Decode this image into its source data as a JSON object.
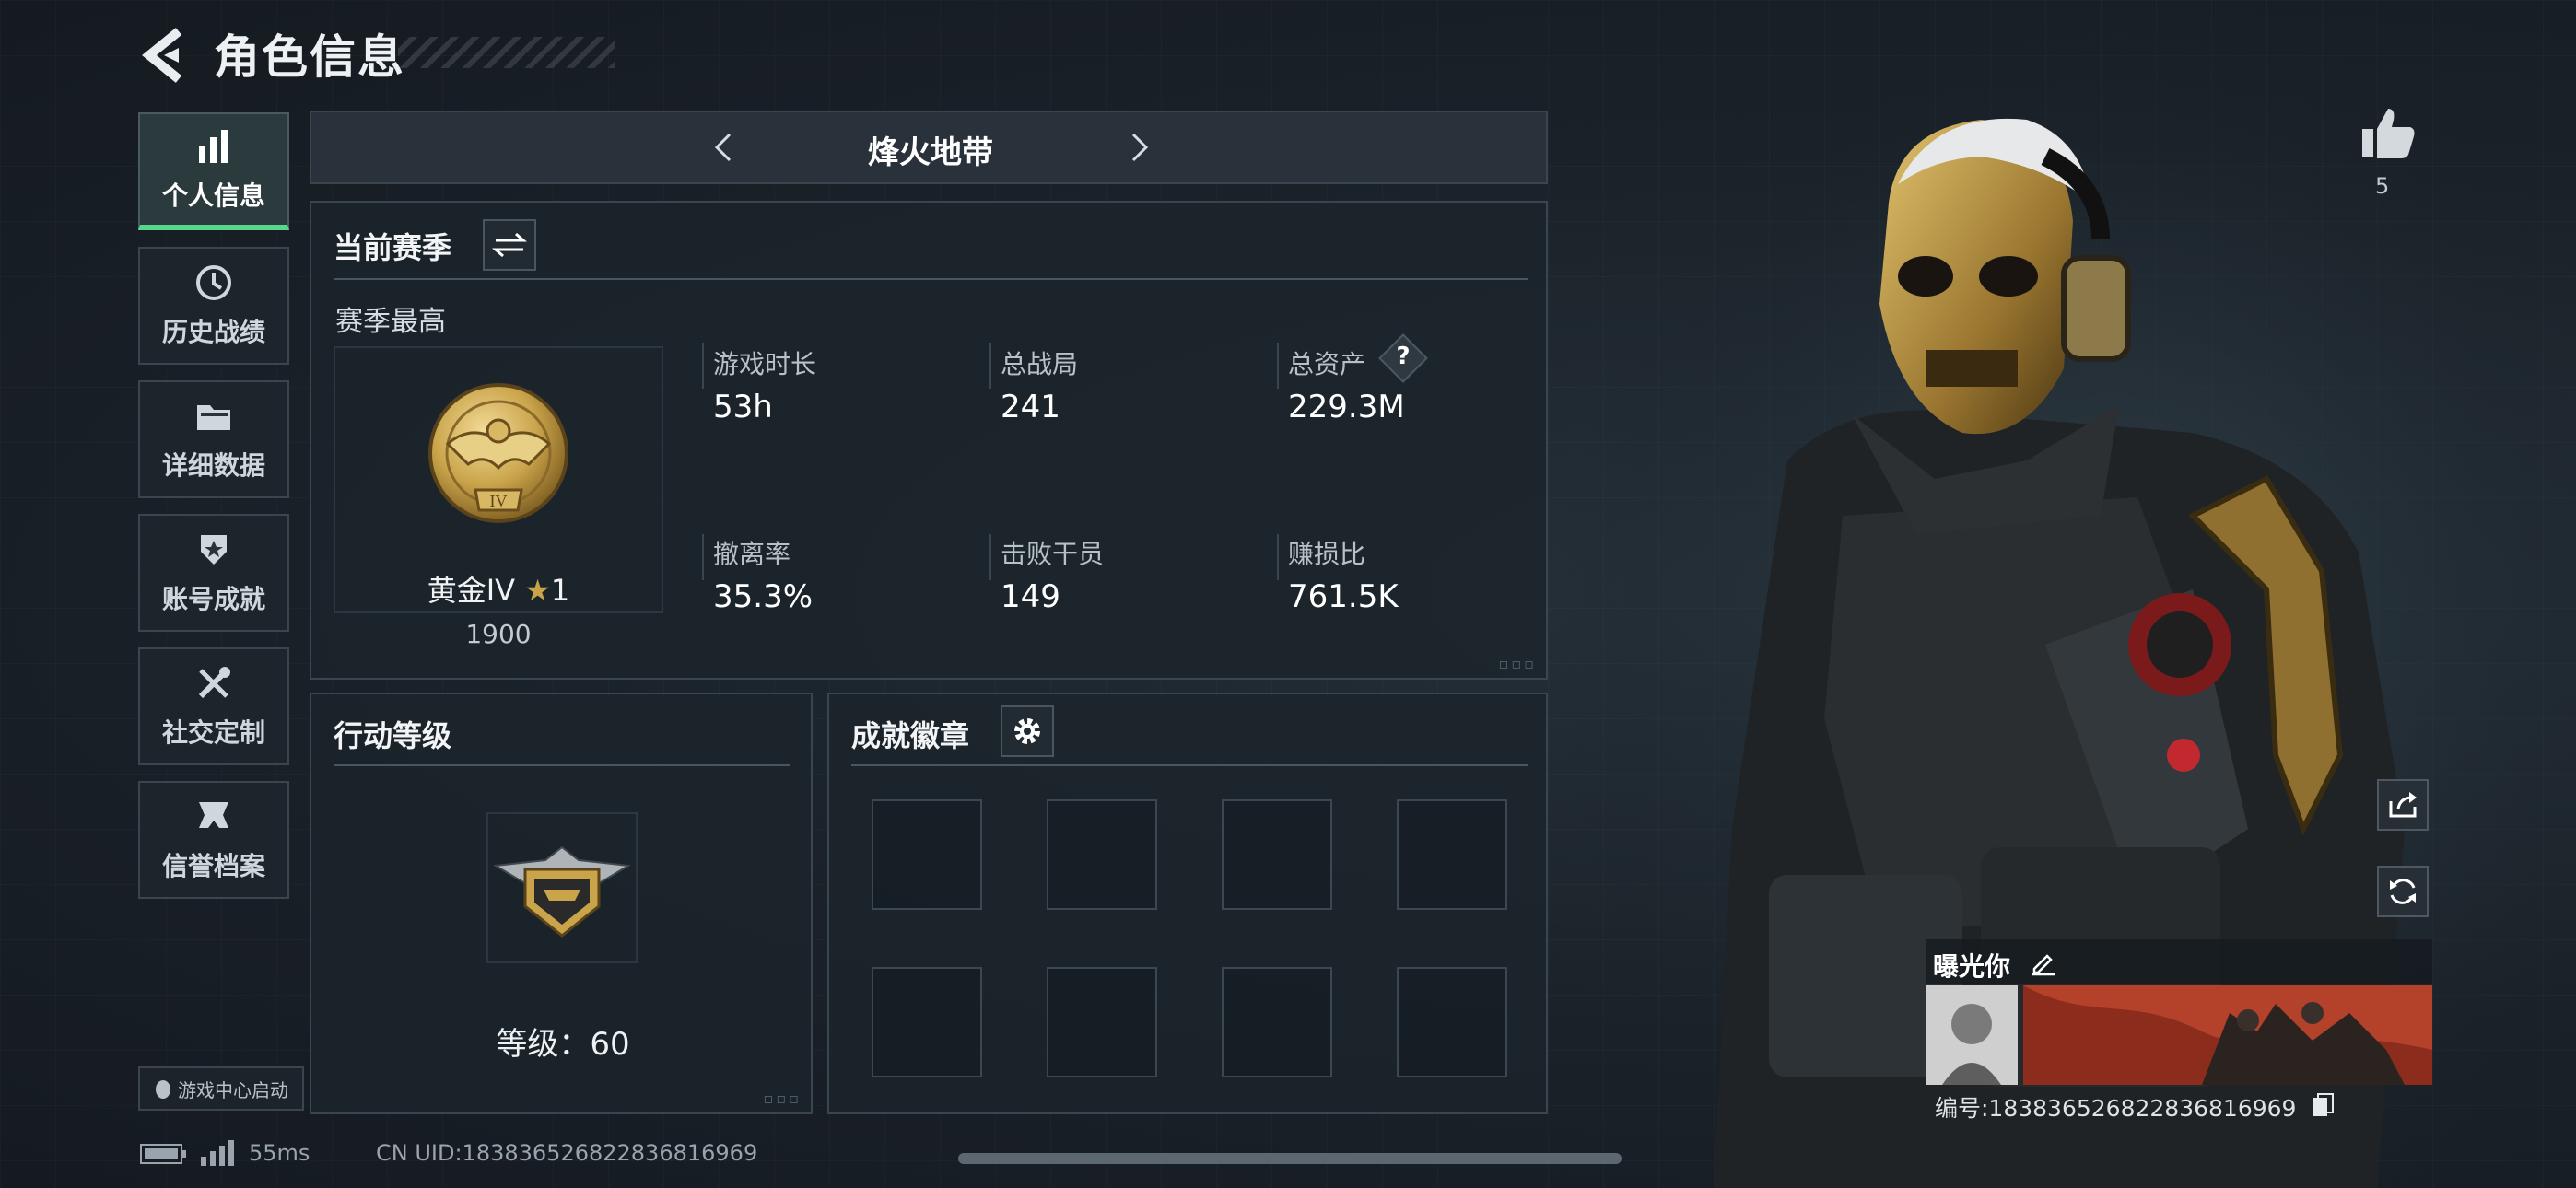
{
  "header": {
    "title": "角色信息"
  },
  "sidebar": {
    "items": [
      {
        "label": "个人信息",
        "icon": "bar-chart-icon",
        "active": true
      },
      {
        "label": "历史战绩",
        "icon": "history-icon",
        "active": false
      },
      {
        "label": "详细数据",
        "icon": "folder-icon",
        "active": false
      },
      {
        "label": "账号成就",
        "icon": "achievement-icon",
        "active": false
      },
      {
        "label": "社交定制",
        "icon": "tools-icon",
        "active": false
      },
      {
        "label": "信誉档案",
        "icon": "credit-icon",
        "active": false
      }
    ],
    "launch_label": "游戏中心启动"
  },
  "mode_selector": {
    "title": "烽火地带"
  },
  "season_panel": {
    "title": "当前赛季",
    "subtitle": "赛季最高",
    "rank_name": "黄金IV",
    "rank_stars": "1",
    "rank_points": "1900",
    "stats": [
      {
        "label": "游戏时长",
        "value": "53h"
      },
      {
        "label": "总战局",
        "value": "241"
      },
      {
        "label": "总资产",
        "value": "229.3M",
        "help": "?"
      },
      {
        "label": "撤离率",
        "value": "35.3%"
      },
      {
        "label": "击败干员",
        "value": "149"
      },
      {
        "label": "赚损比",
        "value": "761.5K"
      }
    ]
  },
  "action_panel": {
    "title": "行动等级",
    "level_label": "等级：",
    "level_value": "60"
  },
  "badge_panel": {
    "title": "成就徽章",
    "slots": 8
  },
  "status_bar": {
    "ping": "55ms",
    "uid": "CN UID:18383652682283681696​9"
  },
  "profile": {
    "likes": "5",
    "card_name": "曝光你",
    "card_id": "编号:18383652682283681696​9"
  },
  "colors": {
    "accent_green": "#58d68d",
    "gold": "#c9a44a",
    "background": "#1a2128"
  }
}
